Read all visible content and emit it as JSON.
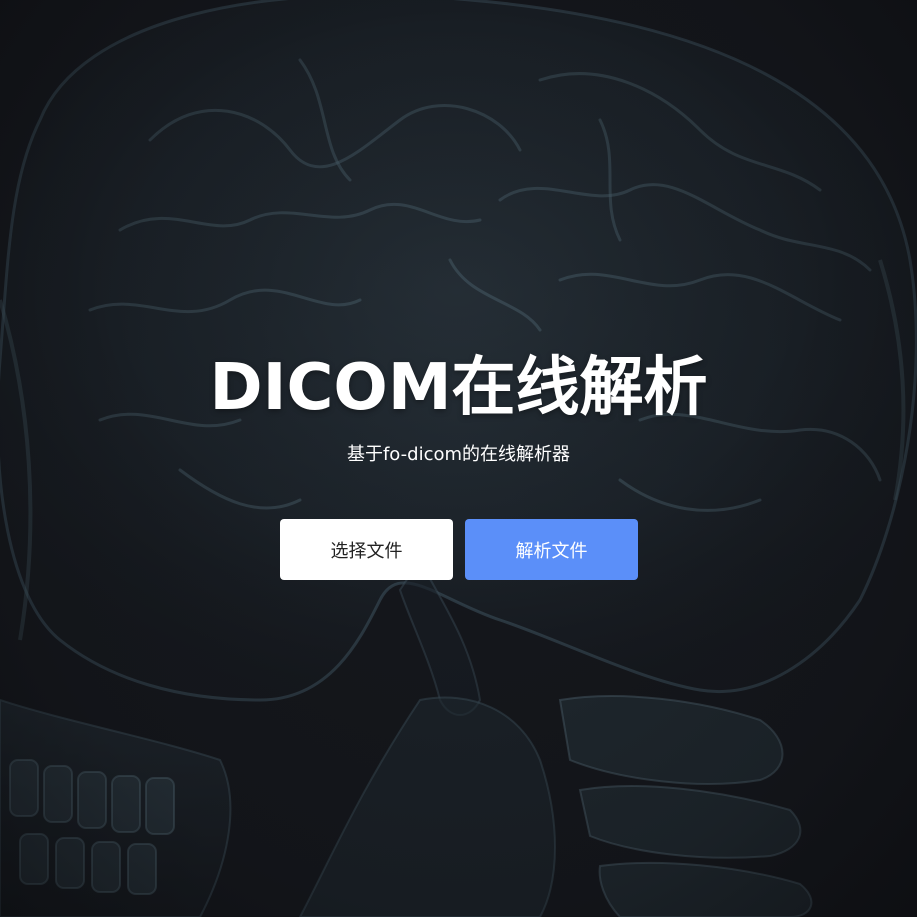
{
  "hero": {
    "title": "DICOM在线解析",
    "subtitle": "基于fo-dicom的在线解析器"
  },
  "actions": {
    "select_file_label": "选择文件",
    "parse_file_label": "解析文件"
  },
  "colors": {
    "background": "#16181d",
    "primary_button": "#5b8ff9",
    "secondary_button": "#ffffff",
    "xray_tint": "#4f6a78"
  },
  "background_image": "xray-skull"
}
